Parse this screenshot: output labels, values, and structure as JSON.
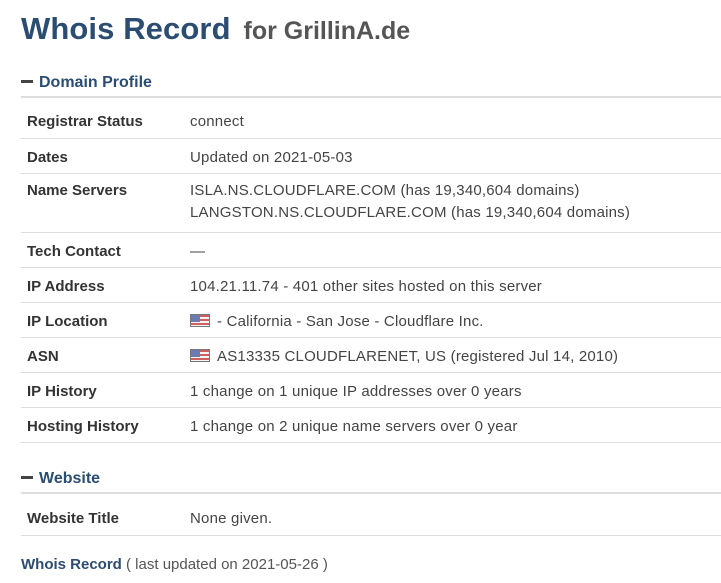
{
  "title": {
    "main": "Whois Record",
    "sub": "for GrillinA.de"
  },
  "sections": {
    "domain_profile": "Domain Profile",
    "website": "Website"
  },
  "profile": {
    "registrar_status": {
      "label": "Registrar Status",
      "value": "connect"
    },
    "dates": {
      "label": "Dates",
      "value": "Updated on 2021-05-03"
    },
    "name_servers": {
      "label": "Name Servers",
      "values": [
        "ISLA.NS.CLOUDFLARE.COM (has 19,340,604 domains)",
        "LANGSTON.NS.CLOUDFLARE.COM (has 19,340,604 domains)"
      ]
    },
    "tech_contact": {
      "label": "Tech Contact",
      "value": "—"
    },
    "ip_address": {
      "label": "IP Address",
      "value": "104.21.11.74 - 401 other sites hosted on this server"
    },
    "ip_location": {
      "label": "IP Location",
      "value": "- California - San Jose - Cloudflare Inc."
    },
    "asn": {
      "label": "ASN",
      "value": "AS13335 CLOUDFLARENET, US (registered Jul 14, 2010)"
    },
    "ip_history": {
      "label": "IP History",
      "value": "1 change on 1 unique IP addresses over 0 years"
    },
    "hosting_history": {
      "label": "Hosting History",
      "value": "1 change on 2 unique name servers over 0 year"
    }
  },
  "website": {
    "website_title": {
      "label": "Website Title",
      "value": "None given."
    }
  },
  "footer": {
    "label": "Whois Record",
    "note": "( last updated on 2021-05-26 )"
  },
  "icons": {
    "flag": "us-flag-icon",
    "collapse": "minus-icon"
  }
}
